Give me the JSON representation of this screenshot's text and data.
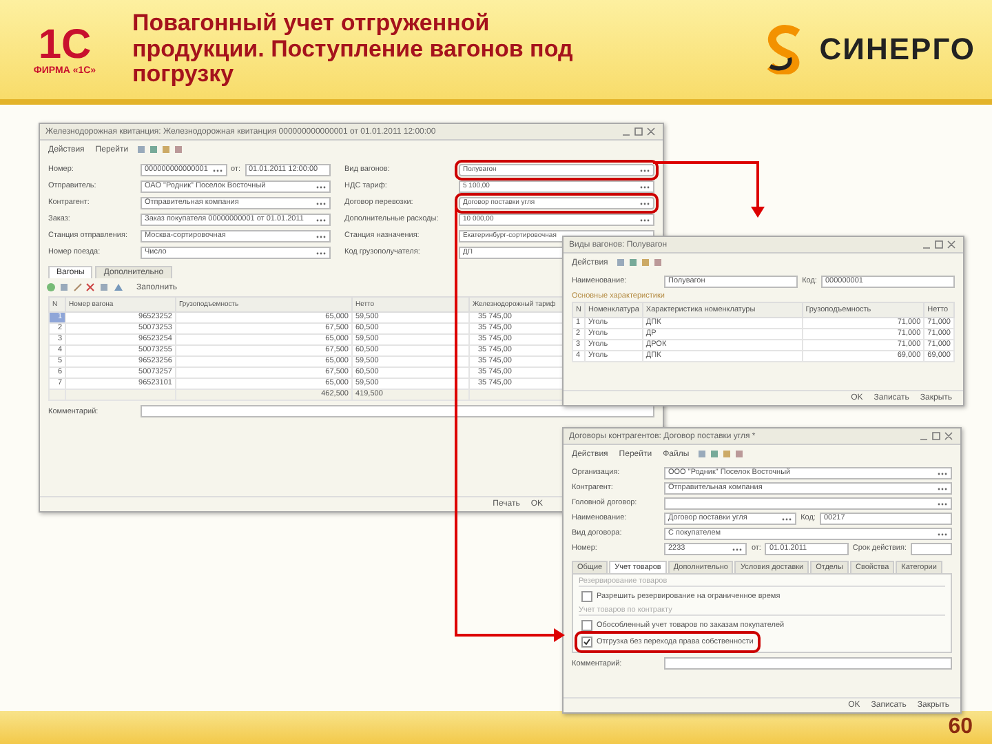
{
  "slide": {
    "logo_mark": "1С",
    "logo_caption": "ФИРМА «1С»",
    "title": "Повагонный учет отгруженной продукции. Поступление вагонов под погрузку",
    "partner_name": "СИНЕРГО",
    "page_number": "60"
  },
  "main_window": {
    "title": "Железнодорожная квитанция: Железнодорожная квитанция 000000000000001 от 01.01.2011 12:00:00",
    "toolbar": [
      "Действия",
      "Перейти"
    ],
    "left_fields": [
      {
        "label": "Номер:",
        "value": "000000000000001",
        "extra_label": "от:",
        "extra_value": "01.01.2011 12:00:00",
        "highlighted": false
      },
      {
        "label": "Отправитель:",
        "value": "ОАО \"Родник\" Поселок Восточный",
        "highlighted": false
      },
      {
        "label": "Контрагент:",
        "value": "Отправительная компания",
        "highlighted": false
      },
      {
        "label": "Заказ:",
        "value": "Заказ покупателя 00000000001 от 01.01.2011",
        "highlighted": false
      },
      {
        "label": "Станция отправления:",
        "value": "Москва-сортировочная",
        "highlighted": false
      },
      {
        "label": "Номер поезда:",
        "value": "Число",
        "highlighted": false
      }
    ],
    "right_fields": [
      {
        "label": "Вид вагонов:",
        "value": "Полувагон",
        "highlighted": true
      },
      {
        "label": "НДС тариф:",
        "value": "5 100,00",
        "highlighted": false
      },
      {
        "label": "Договор перевозки:",
        "value": "Договор поставки угля",
        "highlighted": true
      },
      {
        "label": "Дополнительные расходы:",
        "value": "10 000,00",
        "highlighted": false
      },
      {
        "label": "Станция назначения:",
        "value": "Екатеринбург-сортировочная",
        "highlighted": false
      },
      {
        "label": "Код грузополучателя:",
        "value": "ДП",
        "highlighted": false
      }
    ],
    "tabs": [
      {
        "label": "Вагоны",
        "selected": true
      },
      {
        "label": "Дополнительно",
        "selected": false
      }
    ],
    "table_toolbar_label": "Заполнить",
    "columns": [
      "N",
      "Номер вагона",
      "Грузоподъемность",
      "Нетто",
      "Железнодорожный тариф"
    ],
    "rows": [
      {
        "cells": [
          "1",
          "96523252",
          "65,000",
          "59,500",
          "35 745,00"
        ],
        "selected": true
      },
      {
        "cells": [
          "2",
          "50073253",
          "67,500",
          "60,500",
          "35 745,00"
        ],
        "selected": false
      },
      {
        "cells": [
          "3",
          "96523254",
          "65,000",
          "59,500",
          "35 745,00"
        ],
        "selected": false
      },
      {
        "cells": [
          "4",
          "50073255",
          "67,500",
          "60,500",
          "35 745,00"
        ],
        "selected": false
      },
      {
        "cells": [
          "5",
          "96523256",
          "65,000",
          "59,500",
          "35 745,00"
        ],
        "selected": false
      },
      {
        "cells": [
          "6",
          "50073257",
          "67,500",
          "60,500",
          "35 745,00"
        ],
        "selected": false
      },
      {
        "cells": [
          "7",
          "96523101",
          "65,000",
          "59,500",
          "35 745,00"
        ],
        "selected": false
      }
    ],
    "totals": [
      "462,500",
      "419,500"
    ],
    "comment_label": "Комментарий:",
    "buttons": [
      "Печать",
      "OK"
    ]
  },
  "wagon_window": {
    "title": "Виды вагонов: Полувагон",
    "toolbar": [
      "Действия"
    ],
    "name_label": "Наименование:",
    "name": "Полувагон",
    "code_label": "Код:",
    "code": "000000001",
    "section": "Основные характеристики",
    "columns": [
      "N",
      "Номенклатура",
      "Характеристика номенклатуры",
      "Грузоподъемность",
      "Нетто"
    ],
    "rows": [
      [
        "1",
        "Уголь",
        "ДПК",
        "71,000",
        "71,000"
      ],
      [
        "2",
        "Уголь",
        "ДР",
        "71,000",
        "71,000"
      ],
      [
        "3",
        "Уголь",
        "ДРОК",
        "71,000",
        "71,000"
      ],
      [
        "4",
        "Уголь",
        "ДПК",
        "69,000",
        "69,000"
      ]
    ],
    "buttons": [
      "OK",
      "Записать",
      "Закрыть"
    ]
  },
  "contract_window": {
    "title": "Договоры контрагентов: Договор поставки угля *",
    "toolbar": [
      "Действия",
      "Перейти",
      "Файлы"
    ],
    "fields": [
      {
        "label": "Организация:",
        "value": "ООО \"Родник\" Поселок Восточный"
      },
      {
        "label": "Контрагент:",
        "value": "Отправительная компания"
      },
      {
        "label": "Головной договор:"
      },
      {
        "label": "Наименование:",
        "value": "Договор поставки угля",
        "extra_label": "Код:",
        "extra_value": "00217"
      },
      {
        "label": "Вид договора:",
        "value": "С покупателем"
      },
      {
        "label": "Номер:",
        "value": "2233",
        "extra_label": "от:",
        "extra_value": "01.01.2011",
        "third_label": "Срок действия:"
      }
    ],
    "tabs": [
      {
        "label": "Общие",
        "selected": false
      },
      {
        "label": "Учет товаров",
        "selected": true
      },
      {
        "label": "Дополнительно",
        "selected": false
      },
      {
        "label": "Условия доставки",
        "selected": false
      },
      {
        "label": "Отделы",
        "selected": false
      },
      {
        "label": "Свойства",
        "selected": false
      },
      {
        "label": "Категории",
        "selected": false
      }
    ],
    "groups": [
      {
        "title": "Резервирование товаров",
        "options": [
          {
            "label": "Разрешить резервирование на ограниченное время",
            "checked": false,
            "highlighted": false
          }
        ]
      },
      {
        "title": "Учет товаров по контракту",
        "options": [
          {
            "label": "Обособленный учет товаров по заказам покупателей",
            "checked": false,
            "highlighted": false
          },
          {
            "label": "Отгрузка без перехода права собственности",
            "checked": true,
            "highlighted": true
          }
        ]
      }
    ],
    "comment_label": "Комментарий:",
    "buttons": [
      "OK",
      "Записать",
      "Закрыть"
    ]
  }
}
